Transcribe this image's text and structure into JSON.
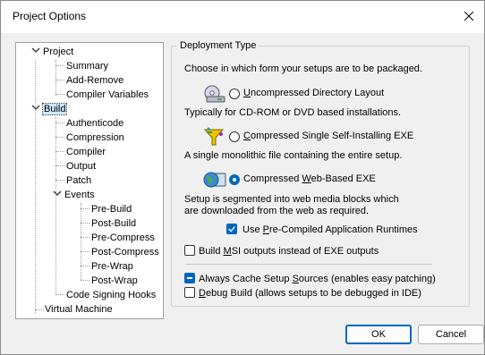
{
  "window": {
    "title": "Project Options"
  },
  "tree": {
    "items": [
      {
        "label": "Project"
      },
      {
        "label": "Summary"
      },
      {
        "label": "Add-Remove"
      },
      {
        "label": "Compiler Variables"
      },
      {
        "label": "Build"
      },
      {
        "label": "Authenticode"
      },
      {
        "label": "Compression"
      },
      {
        "label": "Compiler"
      },
      {
        "label": "Output"
      },
      {
        "label": "Patch"
      },
      {
        "label": "Events"
      },
      {
        "label": "Pre-Build"
      },
      {
        "label": "Post-Build"
      },
      {
        "label": "Pre-Compress"
      },
      {
        "label": "Post-Compress"
      },
      {
        "label": "Pre-Wrap"
      },
      {
        "label": "Post-Wrap"
      },
      {
        "label": "Code Signing Hooks"
      },
      {
        "label": "Virtual Machine"
      }
    ],
    "selected": "Build"
  },
  "deployment": {
    "group_title": "Deployment Type",
    "intro": "Choose in which form your setups are to be packaged.",
    "options": [
      {
        "access_key": "U",
        "label_rest": "ncompressed Directory Layout",
        "description": "Typically for CD-ROM or DVD based installations.",
        "checked": false
      },
      {
        "label_pre": "",
        "access_key": "C",
        "label_rest": "ompressed Single Self-Installing EXE",
        "description": "A single monolithic file containing the entire setup.",
        "checked": false
      },
      {
        "label_pre": "Compressed ",
        "access_key": "W",
        "label_rest": "eb-Based EXE",
        "description_line1": "Setup is segmented into web media blocks which",
        "description_line2": "are downloaded from the web as required.",
        "checked": true
      }
    ],
    "precompiled": {
      "label_pre": "Use ",
      "access_key": "P",
      "label_rest": "re-Compiled Application Runtimes",
      "checked": true
    },
    "msi": {
      "label_pre": "Build ",
      "access_key": "M",
      "label_rest": "SI outputs instead of EXE outputs",
      "checked": false
    }
  },
  "cache": {
    "label_pre": "Always Cache Setup ",
    "access_key": "S",
    "label_rest": "ources (enables easy patching)",
    "state": "indeterminate"
  },
  "debug": {
    "access_key": "D",
    "label_rest": "ebug Build (allows setups to be debugged in IDE)",
    "checked": false
  },
  "buttons": {
    "ok": "OK",
    "cancel": "Cancel"
  },
  "colors": {
    "accent": "#0067c0",
    "selection": "#cce8ff"
  }
}
